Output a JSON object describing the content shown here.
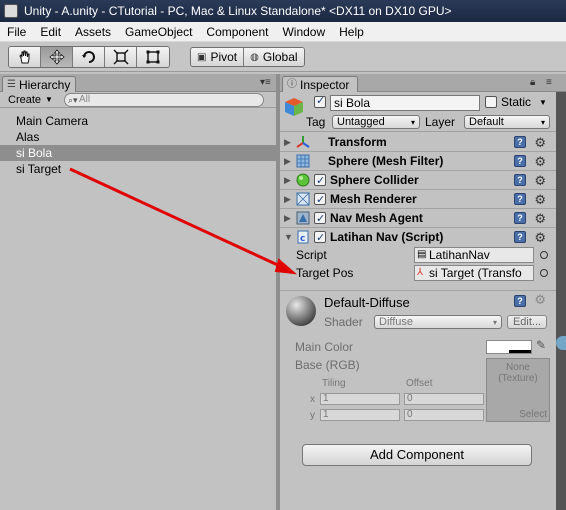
{
  "window": {
    "title": "Unity - A.unity - CTutorial - PC, Mac & Linux Standalone* <DX11 on DX10 GPU>"
  },
  "menu": [
    "File",
    "Edit",
    "Assets",
    "GameObject",
    "Component",
    "Window",
    "Help"
  ],
  "toolbar": {
    "tools": [
      "hand-icon",
      "move-icon",
      "rotate-icon",
      "scale-icon",
      "rect-icon"
    ],
    "pivot_label": "Pivot",
    "global_label": "Global"
  },
  "hierarchy": {
    "tab_label": "Hierarchy",
    "create_label": "Create",
    "search_placeholder": "All",
    "items": [
      {
        "label": "Main Camera",
        "selected": false
      },
      {
        "label": "Alas",
        "selected": false
      },
      {
        "label": "si Bola",
        "selected": true
      },
      {
        "label": "si Target",
        "selected": false
      }
    ]
  },
  "inspector": {
    "tab_label": "Inspector",
    "object_name": "si Bola",
    "static_label": "Static",
    "tag_label": "Tag",
    "tag_value": "Untagged",
    "layer_label": "Layer",
    "layer_value": "Default",
    "components": [
      {
        "name": "Transform",
        "has_checkbox": false,
        "icon": "transform-icon"
      },
      {
        "name": "Sphere (Mesh Filter)",
        "has_checkbox": false,
        "icon": "mesh-filter-icon"
      },
      {
        "name": "Sphere Collider",
        "has_checkbox": true,
        "icon": "sphere-collider-icon"
      },
      {
        "name": "Mesh Renderer",
        "has_checkbox": true,
        "icon": "mesh-renderer-icon"
      },
      {
        "name": "Nav Mesh Agent",
        "has_checkbox": true,
        "icon": "nav-mesh-agent-icon"
      },
      {
        "name": "Latihan Nav (Script)",
        "has_checkbox": true,
        "icon": "script-icon"
      }
    ],
    "script_fields": {
      "script_label": "Script",
      "script_value": "LatihanNav",
      "target_label": "Target Pos",
      "target_value": "si Target (Transfo"
    },
    "material": {
      "name": "Default-Diffuse",
      "shader_label": "Shader",
      "shader_value": "Diffuse",
      "edit_label": "Edit...",
      "main_color_label": "Main Color",
      "base_label": "Base (RGB)",
      "tiling_label": "Tiling",
      "offset_label": "Offset",
      "x_label": "x",
      "y_label": "y",
      "tiling_x": "1",
      "tiling_y": "1",
      "offset_x": "0",
      "offset_y": "0",
      "texture_none_line1": "None",
      "texture_none_line2": "(Texture)",
      "select_label": "Select"
    },
    "add_component_label": "Add Component"
  },
  "colors": {
    "annotation_arrow": "#e00000",
    "selection_bg": "#8e8e8e",
    "panel_bg": "#c2c2c2"
  }
}
